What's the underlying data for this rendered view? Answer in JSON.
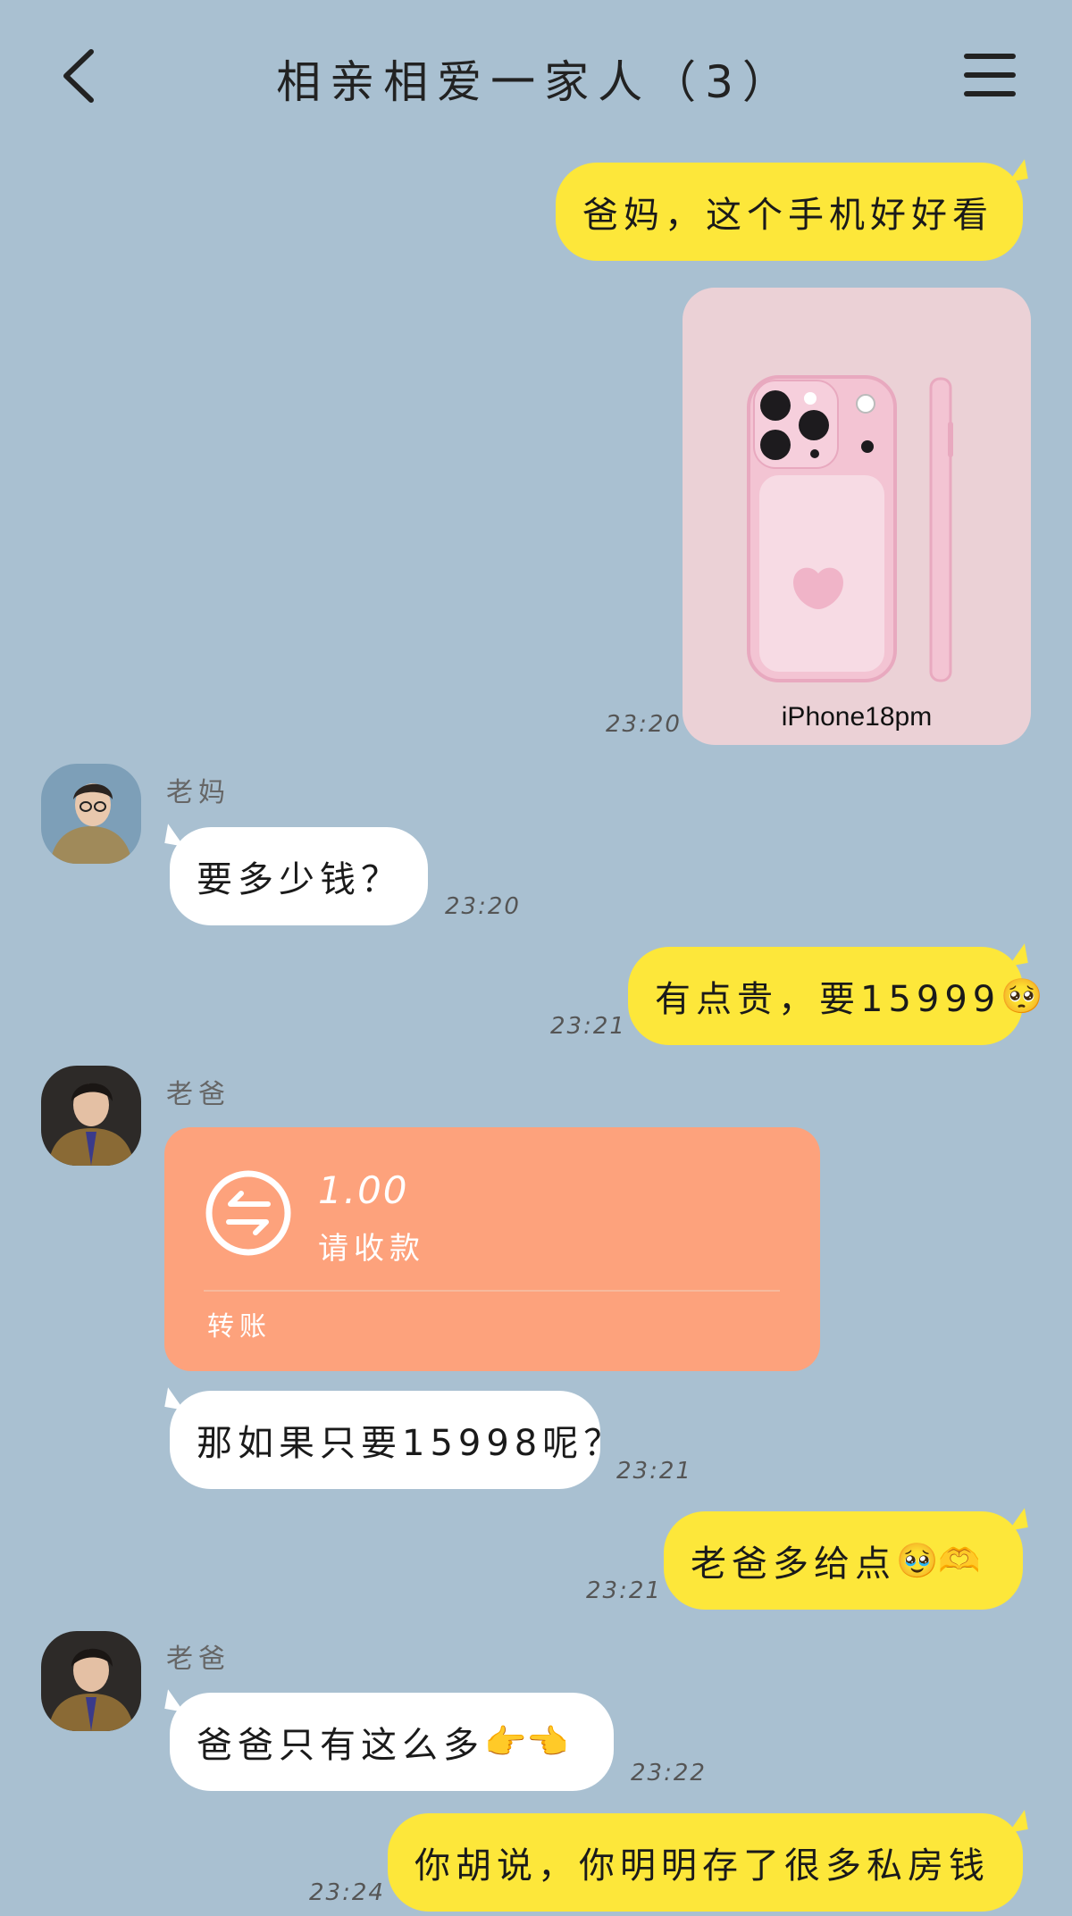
{
  "header": {
    "title": "相亲相爱一家人（3）",
    "back_icon": "chevron-left-icon",
    "menu_icon": "hamburger-menu-icon"
  },
  "messages": {
    "m1": {
      "text": "爸妈，这个手机好好看"
    },
    "m2": {
      "caption": "iPhone18pm",
      "time": "23:20"
    },
    "m3": {
      "sender": "老妈",
      "text": "要多少钱？",
      "time": "23:20"
    },
    "m4": {
      "text": "有点贵，要15999",
      "emoji": "🥺",
      "time": "23:21"
    },
    "m5": {
      "sender": "老爸",
      "amount": "1.00",
      "subtitle": "请收款",
      "footer": "转账"
    },
    "m6": {
      "text": "那如果只要15998呢？",
      "time": "23:21"
    },
    "m7": {
      "text": "老爸多给点",
      "emoji": "🥹🫶",
      "time": "23:21"
    },
    "m8": {
      "sender": "老爸",
      "text": "爸爸只有这么多",
      "emoji": "👉👈",
      "time": "23:22"
    },
    "m9": {
      "text": "你胡说，你明明存了很多私房钱",
      "time": "23:24"
    }
  },
  "colors": {
    "background": "#a9c0d1",
    "my_bubble": "#fde73a",
    "their_bubble": "#ffffff",
    "transfer_card": "#fda27c"
  }
}
